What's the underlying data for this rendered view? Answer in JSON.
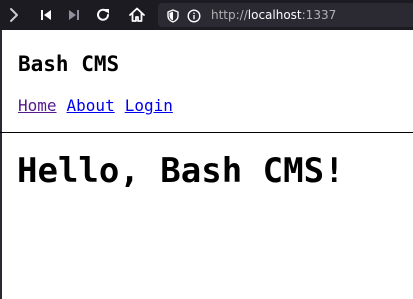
{
  "browser": {
    "url_scheme": "http://",
    "url_host": "localhost",
    "url_port": ":1337",
    "icons": [
      "forward-icon",
      "skip-back-icon",
      "skip-forward-icon",
      "reload-icon",
      "home-icon",
      "shield-icon",
      "info-icon"
    ]
  },
  "page": {
    "site_title": "Bash CMS",
    "nav": [
      {
        "label": "Home",
        "state": "visited"
      },
      {
        "label": "About",
        "state": "link"
      },
      {
        "label": "Login",
        "state": "link"
      }
    ],
    "heading": "Hello, Bash CMS!"
  },
  "colors": {
    "toolbar_bg": "#1c1b22",
    "urlbar_bg": "#2b2a33",
    "link": "#0000ee",
    "visited_link": "#551a8b"
  }
}
